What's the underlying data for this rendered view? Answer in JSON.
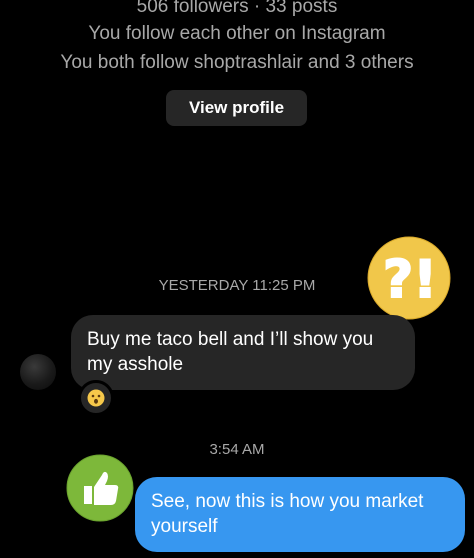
{
  "profile": {
    "stats": "506 followers · 33 posts",
    "mutual_follow": "You follow each other on Instagram",
    "mutual_followers": "You both follow shoptrashlair and 3 others",
    "view_profile_label": "View profile"
  },
  "thread": {
    "timestamp_1": "YESTERDAY 11:25 PM",
    "incoming_message": "Buy me taco bell and I’ll show you my asshole",
    "reaction_icon": "surprised-face-emoji",
    "timestamp_2": "3:54 AM",
    "outgoing_message": "See, now this is how you market yourself"
  },
  "stickers": {
    "top": "?!",
    "bottom": "thumbs-up"
  },
  "colors": {
    "background": "#000000",
    "incoming_bubble": "#262626",
    "outgoing_bubble": "#3797f0",
    "sticker_yellow": "#f1c74a",
    "sticker_green": "#7db83a"
  }
}
